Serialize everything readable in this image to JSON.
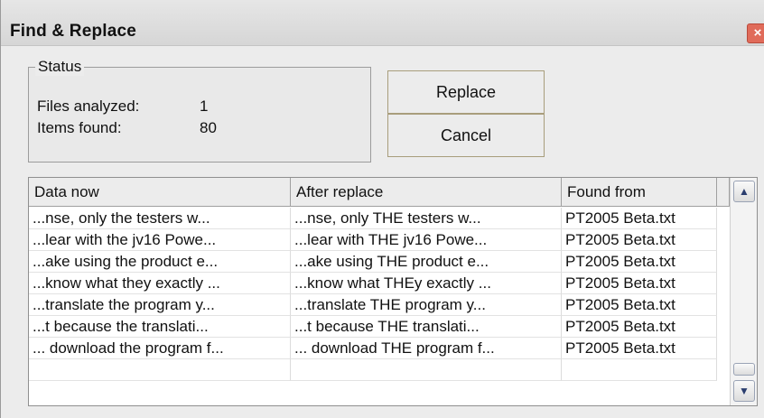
{
  "window": {
    "title": "Find & Replace",
    "close_glyph": "×"
  },
  "status": {
    "legend": "Status",
    "files_label": "Files analyzed:",
    "files_value": "1",
    "items_label": "Items found:",
    "items_value": "80"
  },
  "buttons": {
    "replace": "Replace",
    "cancel": "Cancel"
  },
  "table": {
    "columns": [
      "Data now",
      "After replace",
      "Found from"
    ],
    "rows": [
      [
        "...nse, only the testers w...",
        "...nse, only THE testers w...",
        "PT2005 Beta.txt"
      ],
      [
        "...lear with the jv16 Powe...",
        "...lear with THE jv16 Powe...",
        "PT2005 Beta.txt"
      ],
      [
        "...ake using the product e...",
        "...ake using THE product e...",
        "PT2005 Beta.txt"
      ],
      [
        "...know what they exactly ...",
        "...know what THEy exactly ...",
        "PT2005 Beta.txt"
      ],
      [
        "...translate the program y...",
        "...translate THE program y...",
        "PT2005 Beta.txt"
      ],
      [
        "...t because the translati...",
        "...t because THE translati...",
        "PT2005 Beta.txt"
      ],
      [
        "... download the program f...",
        "... download THE program f...",
        "PT2005 Beta.txt"
      ],
      [
        "",
        "",
        ""
      ]
    ]
  },
  "scrollbar": {
    "up_icon": "chevron-up-icon",
    "down_icon": "chevron-down-icon",
    "up_glyph": "▲",
    "down_glyph": "▼"
  },
  "colors": {
    "close_button": "#e06b5a",
    "button_border": "#a89d7c",
    "window_bg": "#ececec"
  }
}
